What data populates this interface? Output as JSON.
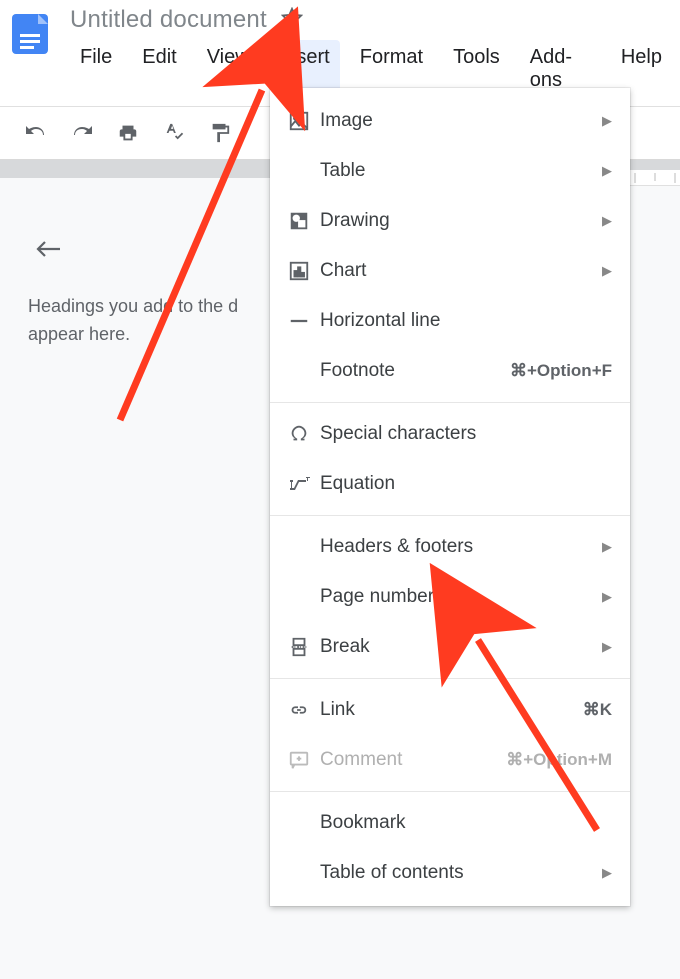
{
  "header": {
    "title": "Untitled document",
    "menus": {
      "file": "File",
      "edit": "Edit",
      "view": "View",
      "insert": "Insert",
      "format": "Format",
      "tools": "Tools",
      "addons": "Add-ons",
      "help": "Help"
    }
  },
  "outline": {
    "hint_line1": "Headings you add to the d",
    "hint_line2": "appear here."
  },
  "insert_menu": {
    "image": "Image",
    "table": "Table",
    "drawing": "Drawing",
    "chart": "Chart",
    "horizontal_line": "Horizontal line",
    "footnote": "Footnote",
    "footnote_shortcut": "⌘+Option+F",
    "special_characters": "Special characters",
    "equation": "Equation",
    "headers_footers": "Headers & footers",
    "page_numbers": "Page numbers",
    "break": "Break",
    "link": "Link",
    "link_shortcut": "⌘K",
    "comment": "Comment",
    "comment_shortcut": "⌘+Option+M",
    "bookmark": "Bookmark",
    "table_of_contents": "Table of contents"
  }
}
